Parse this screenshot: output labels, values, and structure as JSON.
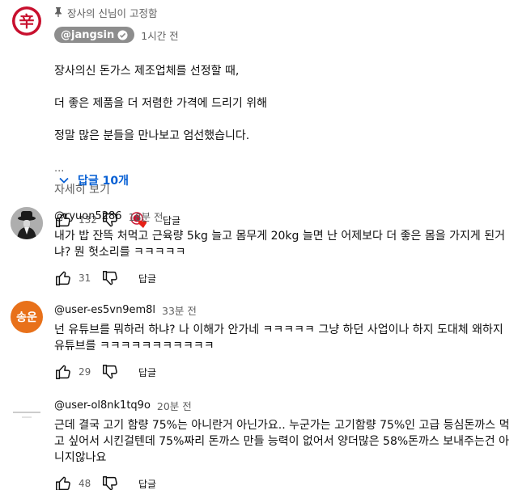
{
  "comments": [
    {
      "pinned_label": "장사의 신님이 고정함",
      "author": "@jangsin",
      "time": "1시간 전",
      "text_lines": [
        "장사의신 돈가스 제조업체를 선정할 때,",
        "더 좋은 제품을 더 저렴한 가격에 드리기 위해",
        "정말 많은 분들을 만나보고 엄선했습니다."
      ],
      "ellipsis": "...",
      "more_label": "자세히 보기",
      "likes": "132",
      "reply_label": "답글",
      "replies_toggle": "답글 10개"
    },
    {
      "author": "@ryuon5286",
      "time": "18분 전",
      "text": "내가 밥 잔뜩 처먹고 근육량 5kg 늘고 몸무게 20kg 늘면 난 어제보다 더 좋은 몸을 가지게 된거냐? 뭔 헛소리를 ㅋㅋㅋㅋㅋ",
      "likes": "31",
      "reply_label": "답글"
    },
    {
      "author": "@user-es5vn9em8l",
      "avatar_text": "송운",
      "avatar_color": "#e8711a",
      "time": "33분 전",
      "text": "넌 유튜브를 뭐하러 하냐? 나 이해가 안가네 ㅋㅋㅋㅋㅋ 그냥 하던 사업이나 하지 도대체 왜하지 유튜브를 ㅋㅋㅋㅋㅋㅋㅋㅋㅋㅋㅋ",
      "likes": "29",
      "reply_label": "답글"
    },
    {
      "author": "@user-ol8nk1tq9o",
      "time": "20분 전",
      "text": "근데 결국 고기 함량 75%는 아니란거 아닌가요.. 누군가는 고기함량 75%인 고급 등심돈까스 먹고 싶어서 시킨걸텐데 75%짜리 돈까스 만들 능력이 없어서 양더많은 58%돈까스 보내주는건 아니지않나요",
      "likes": "48",
      "reply_label": "답글"
    }
  ],
  "colors": {
    "link_blue": "#065fd4",
    "muted": "#606060",
    "heart": "#e62117",
    "logo_red": "#c8102e"
  }
}
